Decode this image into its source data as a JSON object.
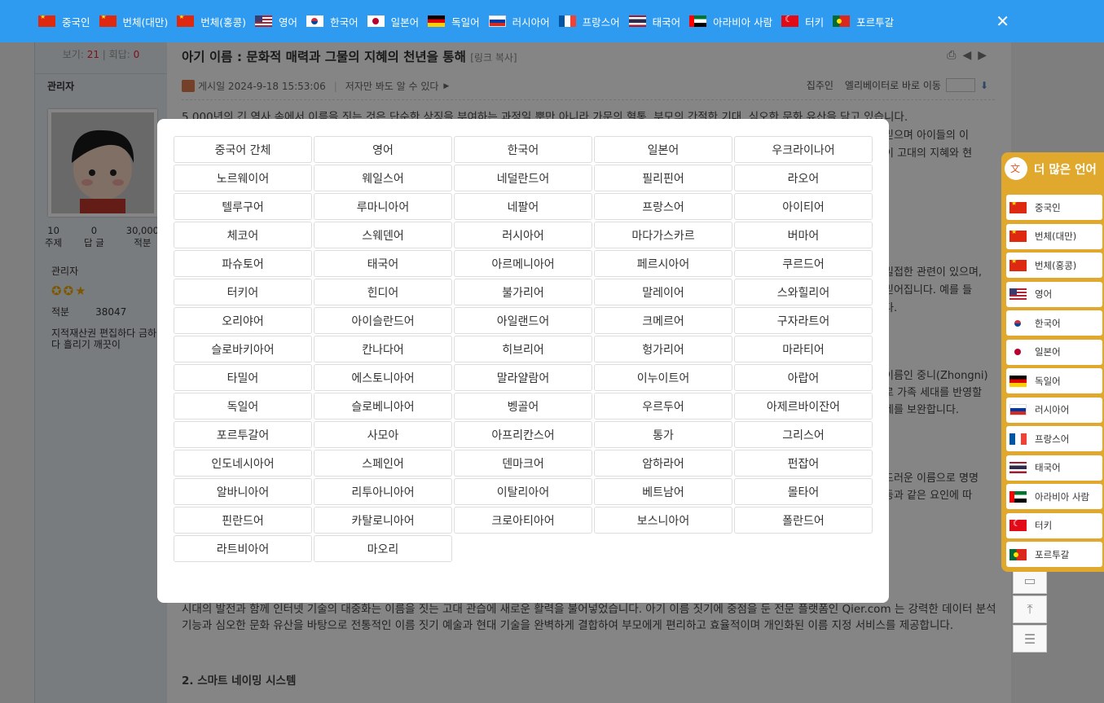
{
  "topbar": {
    "languages": [
      {
        "label": "중국인",
        "flag": "cn"
      },
      {
        "label": "번체(대만)",
        "flag": "cn"
      },
      {
        "label": "번체(홍콩)",
        "flag": "cn"
      },
      {
        "label": "영어",
        "flag": "us"
      },
      {
        "label": "한국어",
        "flag": "kr"
      },
      {
        "label": "일본어",
        "flag": "jp"
      },
      {
        "label": "독일어",
        "flag": "de"
      },
      {
        "label": "러시아어",
        "flag": "ru"
      },
      {
        "label": "프랑스어",
        "flag": "fr"
      },
      {
        "label": "태국어",
        "flag": "th"
      },
      {
        "label": "아라비아 사람",
        "flag": "ae"
      },
      {
        "label": "터키",
        "flag": "tr"
      },
      {
        "label": "포르투갈",
        "flag": "pt"
      }
    ],
    "close_label": "✕"
  },
  "left": {
    "views_label": "보기:",
    "views_value": "21",
    "replies_label": "회답:",
    "replies_value": "0",
    "author": "관리자",
    "stats": [
      {
        "value": "10",
        "label": "주제"
      },
      {
        "value": "0",
        "label": "답 글"
      },
      {
        "value": "30,000",
        "label": "적분"
      }
    ],
    "rank": "관리자",
    "points_label": "적분",
    "points_value": "38047",
    "note": "지적재산권 편집하다 금하다 흘리기 깨끗이"
  },
  "post": {
    "title": "아기 이름 : 문화적 매력과 그물의 지혜의 천년을 통해",
    "copy_link": "[링크 복사]",
    "posted": "게시일 2024-9-18 15:53:06",
    "author_only": "저자만 봐도 알 수 있다",
    "owner": "집주인",
    "elevator": "엘리베이터로 바로 이동",
    "p1": "5,000년의 긴 역사 속에서 이름을 짓는 것은 단순한 상징을 부여하는 과정일 뿐만 아니라 가문의 혈통, 부모의 간절한 기대, 심오한 문화 유산을 담고 있습니다.",
    "frag1": "믿으며 아이들의 이",
    "frag2": "이 고대의 지혜와 현",
    "frag3": "밀접한 관련이 있으며,",
    "frag4": "믿어집니다. 예를 들",
    "frag5": "다.",
    "frag6": "이름인 중니(Zhongni)",
    "frag7": "로 가족 세대를 반영할",
    "frag8": "네를 보완합니다.",
    "frag9": "드러운 이름으로 명명",
    "frag10": "등과 같은 요인에 따",
    "p_bottom": "시대의 발전과 함께 인터넷 기술의 대중화는 이름을 짓는 고대 관습에 새로운 활력을 불어넣었습니다. 아기 이름 짓기에 중점을 둔 전문 플랫폼인 Qier.com 는 강력한 데이터 분석 기능과 심오한 문화 유산을 바탕으로 전통적인 이름 짓기 예술과 현대 기술을 완벽하게 결합하여 부모에게 편리하고 효율적이며 개인화된 이름 지정 서비스를 제공합니다.",
    "heading2": "2. 스마트 네이밍 시스템"
  },
  "modal": {
    "languages": [
      "중국어 간체",
      "영어",
      "한국어",
      "일본어",
      "우크라이나어",
      "노르웨이어",
      "웨일스어",
      "네덜란드어",
      "필리핀어",
      "라오어",
      "텔루구어",
      "루마니아어",
      "네팔어",
      "프랑스어",
      "아이티어",
      "체코어",
      "스웨덴어",
      "러시아어",
      "마다가스카르",
      "버마어",
      "파슈토어",
      "태국어",
      "아르메니아어",
      "페르시아어",
      "쿠르드어",
      "터키어",
      "힌디어",
      "불가리어",
      "말레이어",
      "스와힐리어",
      "오리야어",
      "아이슬란드어",
      "아일랜드어",
      "크메르어",
      "구자라트어",
      "슬로바키아어",
      "칸나다어",
      "히브리어",
      "헝가리어",
      "마라티어",
      "타밀어",
      "에스토니아어",
      "말라얄람어",
      "이누이트어",
      "아랍어",
      "독일어",
      "슬로베니아어",
      "벵골어",
      "우르두어",
      "아제르바이잔어",
      "포르투갈어",
      "사모아",
      "아프리칸스어",
      "통가",
      "그리스어",
      "인도네시아어",
      "스페인어",
      "덴마크어",
      "암하라어",
      "펀잡어",
      "알바니아어",
      "리투아니아어",
      "이탈리아어",
      "베트남어",
      "몰타어",
      "핀란드어",
      "카탈로니아어",
      "크로아티아어",
      "보스니아어",
      "폴란드어",
      "라트비아어",
      "마오리"
    ]
  },
  "sidepanel": {
    "title": "더 많은 언어",
    "items": [
      {
        "label": "중국인",
        "flag": "cn"
      },
      {
        "label": "번체(대만)",
        "flag": "cn"
      },
      {
        "label": "번체(홍콩)",
        "flag": "cn"
      },
      {
        "label": "영어",
        "flag": "us"
      },
      {
        "label": "한국어",
        "flag": "kr"
      },
      {
        "label": "일본어",
        "flag": "jp"
      },
      {
        "label": "독일어",
        "flag": "de"
      },
      {
        "label": "러시아어",
        "flag": "ru"
      },
      {
        "label": "프랑스어",
        "flag": "fr"
      },
      {
        "label": "태국어",
        "flag": "th"
      },
      {
        "label": "아라비아 사람",
        "flag": "ae"
      },
      {
        "label": "터키",
        "flag": "tr"
      },
      {
        "label": "포르투갈",
        "flag": "pt"
      }
    ]
  },
  "colors": {
    "topbar": "#2e9bf0",
    "side_panel": "#e0a82c",
    "accent_red": "#e23333"
  }
}
